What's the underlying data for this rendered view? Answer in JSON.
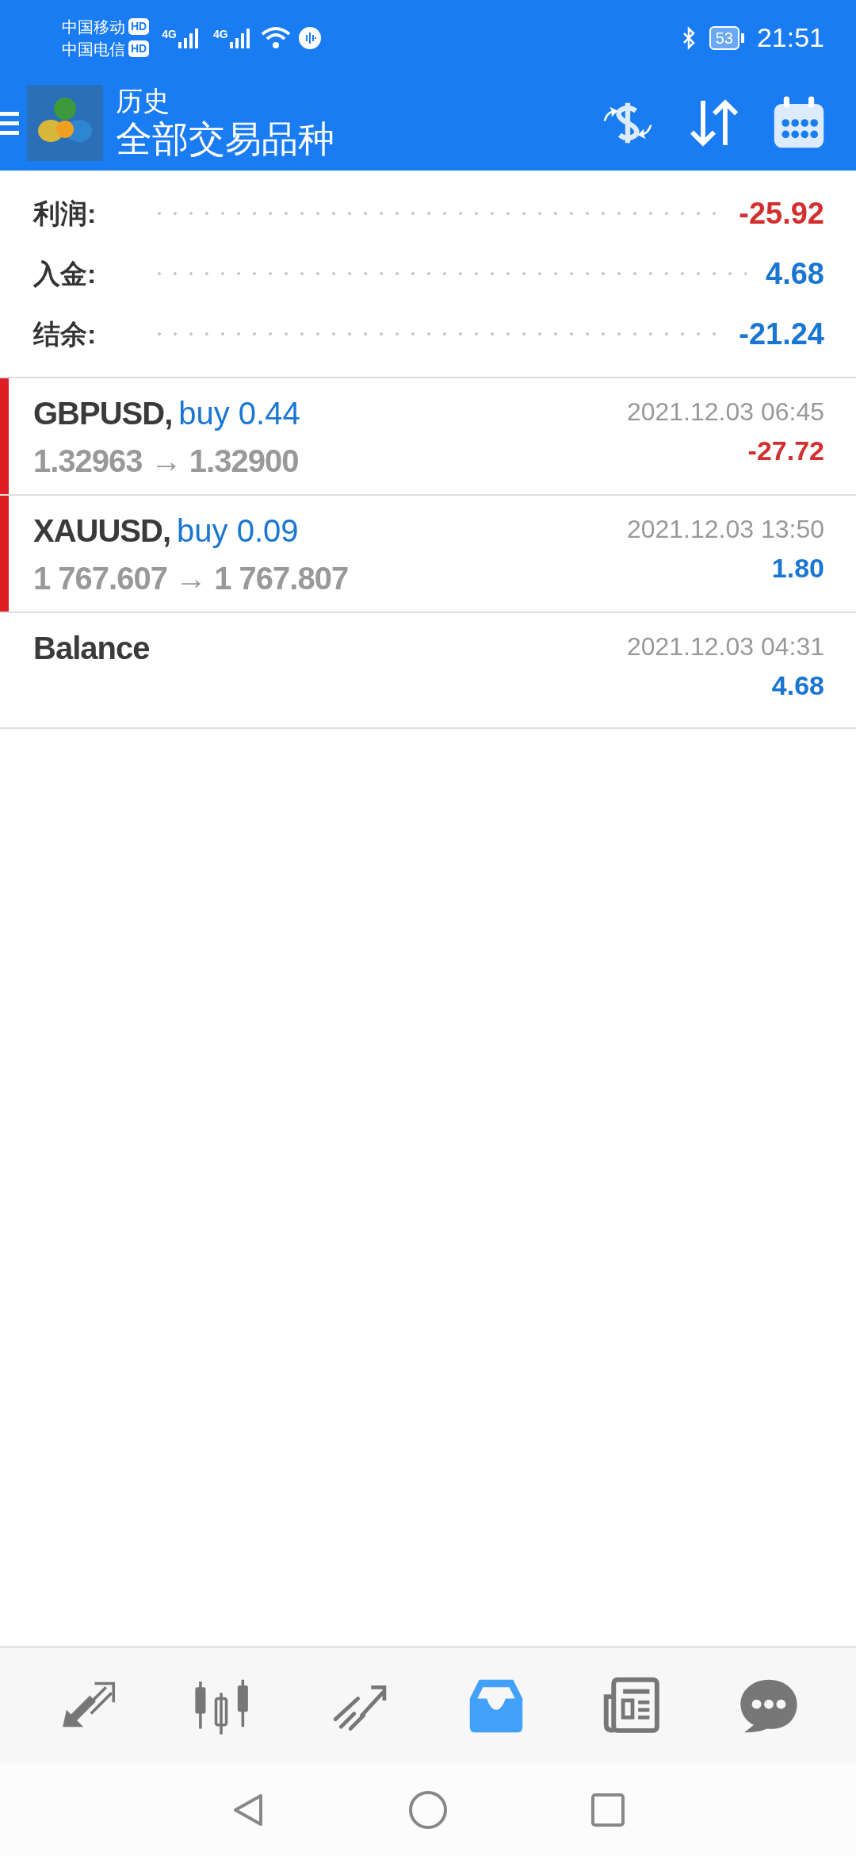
{
  "status_bar": {
    "carriers": [
      {
        "name": "中国移动",
        "badge": "HD"
      },
      {
        "name": "中国电信",
        "badge": "HD"
      }
    ],
    "networks": [
      "4G",
      "4G"
    ],
    "battery": "53",
    "time": "21:51"
  },
  "header": {
    "title": "历史",
    "subtitle": "全部交易品种"
  },
  "summary": [
    {
      "label": "利润:",
      "value": "-25.92",
      "color": "#d32f2f"
    },
    {
      "label": "入金:",
      "value": "4.68",
      "color": "#1976d2"
    },
    {
      "label": "结余:",
      "value": "-21.24",
      "color": "#1976d2"
    }
  ],
  "deals": [
    {
      "kind": "trade",
      "symbol": "GBPUSD,",
      "action": "buy 0.44",
      "prices": "1.32963 → 1.32900",
      "time": "2021.12.03 06:45",
      "profit": "-27.72",
      "color": "#d32f2f"
    },
    {
      "kind": "trade",
      "symbol": "XAUUSD,",
      "action": "buy 0.09",
      "prices": "1 767.607 → 1 767.807",
      "time": "2021.12.03 13:50",
      "profit": "1.80",
      "color": "#1976d2"
    },
    {
      "kind": "balance",
      "symbol": "Balance",
      "time": "2021.12.03 04:31",
      "profit": "4.68",
      "color": "#1976d2"
    }
  ],
  "bottom_nav": [
    {
      "kind": "trade",
      "selected": false
    },
    {
      "kind": "chart",
      "selected": false
    },
    {
      "kind": "trend",
      "selected": false
    },
    {
      "kind": "history",
      "selected": true
    },
    {
      "kind": "news",
      "selected": false
    },
    {
      "kind": "chat",
      "selected": false
    }
  ]
}
